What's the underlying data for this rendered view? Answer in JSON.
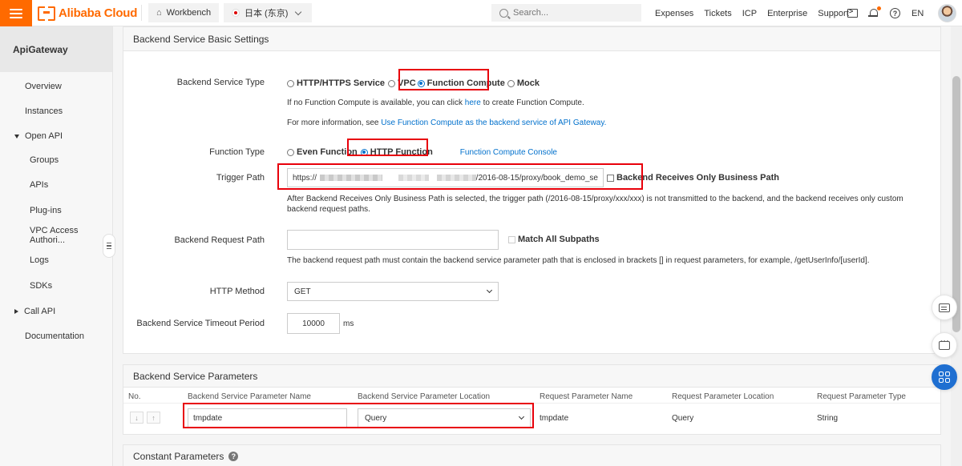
{
  "topbar": {
    "logo_text": "Alibaba Cloud",
    "workbench": "Workbench",
    "region": "日本 (东京)",
    "search_placeholder": "Search...",
    "links": [
      "Expenses",
      "Tickets",
      "ICP",
      "Enterprise",
      "Support"
    ],
    "lang": "EN"
  },
  "sidebar": {
    "title": "ApiGateway",
    "items": {
      "overview": "Overview",
      "instances": "Instances",
      "open_api": "Open API",
      "groups": "Groups",
      "apis": "APIs",
      "plugins": "Plug-ins",
      "vpc": "VPC Access Authori...",
      "logs": "Logs",
      "sdks": "SDKs",
      "call_api": "Call API",
      "documentation": "Documentation"
    }
  },
  "basic": {
    "title": "Backend Service Basic Settings",
    "service_type_label": "Backend Service Type",
    "service_types": [
      "HTTP/HTTPS Service",
      "VPC",
      "Function Compute",
      "Mock"
    ],
    "selected_service_type": "Function Compute",
    "fc_hint_before": "If no Function Compute is available, you can click",
    "fc_hint_link": "here",
    "fc_hint_after": "to create Function Compute.",
    "more_info_before": "For more information, see",
    "more_info_link": "Use Function Compute as the backend service of API Gateway.",
    "function_type_label": "Function Type",
    "function_types": [
      "Even Function",
      "HTTP Function"
    ],
    "selected_function_type": "HTTP Function",
    "console_link": "Function Compute Console",
    "trigger_label": "Trigger Path",
    "trigger_prefix": "https://",
    "trigger_suffix": "/2016-08-15/proxy/book_demo_se",
    "business_path_label": "Backend Receives Only Business Path",
    "business_path_note": "After Backend Receives Only Business Path is selected, the trigger path (/2016-08-15/proxy/xxx/xxx) is not transmitted to the backend, and the backend receives only custom backend request paths.",
    "request_path_label": "Backend Request Path",
    "request_path_value": "",
    "match_subpaths_label": "Match All Subpaths",
    "request_path_note": "The backend request path must contain the backend service parameter path that is enclosed in brackets [] in request parameters, for example, /getUserInfo/[userId].",
    "method_label": "HTTP Method",
    "method_value": "GET",
    "timeout_label": "Backend Service Timeout Period",
    "timeout_value": "10000",
    "timeout_unit": "ms"
  },
  "params": {
    "title": "Backend Service Parameters",
    "columns": [
      "No.",
      "Backend Service Parameter Name",
      "Backend Service Parameter Location",
      "Request Parameter Name",
      "Request Parameter Location",
      "Request Parameter Type"
    ],
    "row": {
      "name": "tmpdate",
      "location": "Query",
      "request_name": "tmpdate",
      "request_location": "Query",
      "request_type": "String"
    }
  },
  "constant": {
    "title": "Constant Parameters"
  }
}
